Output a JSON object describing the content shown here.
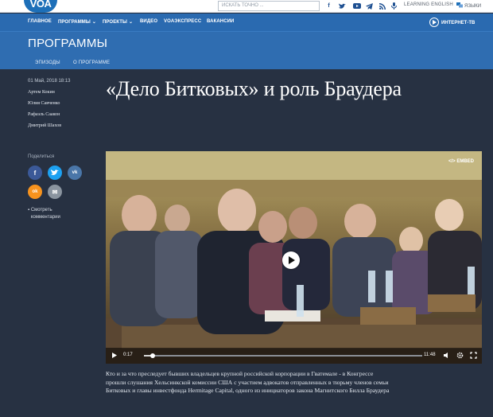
{
  "header": {
    "logo_text": "VOA",
    "search_placeholder": "ИСКАТЬ ТОЧНО ...",
    "social_icons": [
      "facebook-icon",
      "twitter-icon",
      "youtube-icon",
      "telegram-icon",
      "rss-icon",
      "podcast-icon"
    ],
    "learning_english": "LEARNING ENGLISH",
    "languages": "ЯЗЫКИ"
  },
  "nav": {
    "items": [
      {
        "label": "ГЛАВНОЕ",
        "dropdown": false
      },
      {
        "label": "ПРОГРАММЫ",
        "dropdown": true
      },
      {
        "label": "ПРОЕКТЫ",
        "dropdown": true
      },
      {
        "label": "ВИДЕО",
        "dropdown": false
      },
      {
        "label": "VOAЭКСПРЕСС",
        "dropdown": false
      },
      {
        "label": "ВАКАНСИИ",
        "dropdown": false
      }
    ],
    "internet_tv": "ИНТЕРНЕТ-ТВ"
  },
  "section": {
    "title": "ПРОГРАММЫ",
    "tabs": [
      "ЭПИЗОДЫ",
      "О ПРОГРАММЕ"
    ]
  },
  "article": {
    "date": "01 Май, 2018 18:13",
    "authors": [
      "Артем Кокин",
      "Юлия Савченко",
      "Рафаэль Саакон",
      "Дмитрий Шахов"
    ],
    "headline": "«Дело Битковых» и роль Браудера",
    "caption": "Кто и за что преследует бывших владельцев крупной российской корпорации в Гватемале - в Конгрессе прошли слушания Хельсинкской комиссии США с участием адвокатов отправленных в тюрьму членов семьи Битковых и главы инвестфонда Hermitage Capital, одного из инициаторов закона Магнитского Билла Браудера"
  },
  "share": {
    "label": "Поделиться",
    "buttons": [
      {
        "name": "facebook",
        "glyph": "f",
        "color": "#3b5998"
      },
      {
        "name": "twitter",
        "glyph": "t",
        "color": "#1da1f2"
      },
      {
        "name": "vk",
        "glyph": "vk",
        "color": "#4a76a8"
      },
      {
        "name": "odnoklassniki",
        "glyph": "ok",
        "color": "#f7931e"
      },
      {
        "name": "email",
        "glyph": "✉",
        "color": "#8a949f"
      }
    ],
    "comments": "Смотреть комментарии"
  },
  "video": {
    "embed_label": "EMBED",
    "current_time": "0:17",
    "duration": "11:48",
    "progress": 0.03
  }
}
